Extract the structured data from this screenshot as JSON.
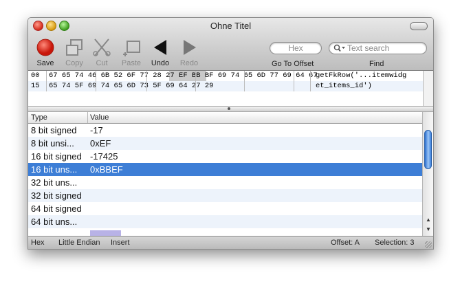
{
  "window": {
    "title": "Ohne Titel"
  },
  "toolbar": {
    "save": "Save",
    "copy": "Copy",
    "cut": "Cut",
    "paste": "Paste",
    "undo": "Undo",
    "redo": "Redo",
    "hex_placeholder": "Hex",
    "search_placeholder": "Text search",
    "goto_label": "Go To Offset",
    "find_label": "Find"
  },
  "hex": {
    "rows": [
      {
        "offset": "00",
        "bytes": "67 65 74 46 6B 52 6F 77 28 27 EF BB BF 69 74 65 6D 77 69 64 67",
        "ascii": "getFkRow('...itemwidg"
      },
      {
        "offset": "15",
        "bytes": "65 74 5F 69 74 65 6D 73 5F 69 64 27 29",
        "ascii": "et_items_id')"
      }
    ]
  },
  "table": {
    "headers": {
      "type": "Type",
      "value": "Value"
    },
    "rows": [
      {
        "type": "8 bit signed",
        "value": "-17"
      },
      {
        "type": "8 bit unsi...",
        "value": "0xEF"
      },
      {
        "type": "16 bit signed",
        "value": "-17425"
      },
      {
        "type": "16 bit uns...",
        "value": "0xBBEF"
      },
      {
        "type": "32 bit uns...",
        "value": ""
      },
      {
        "type": "32 bit signed",
        "value": ""
      },
      {
        "type": "64 bit signed",
        "value": ""
      },
      {
        "type": "64 bit uns...",
        "value": ""
      }
    ]
  },
  "status": {
    "mode": "Hex",
    "endian": "Little Endian",
    "insert": "Insert",
    "offset": "Offset: A",
    "selection": "Selection: 3"
  },
  "colors": {
    "selection": "#3d7ed6",
    "accent_red": "#d42a1a"
  }
}
